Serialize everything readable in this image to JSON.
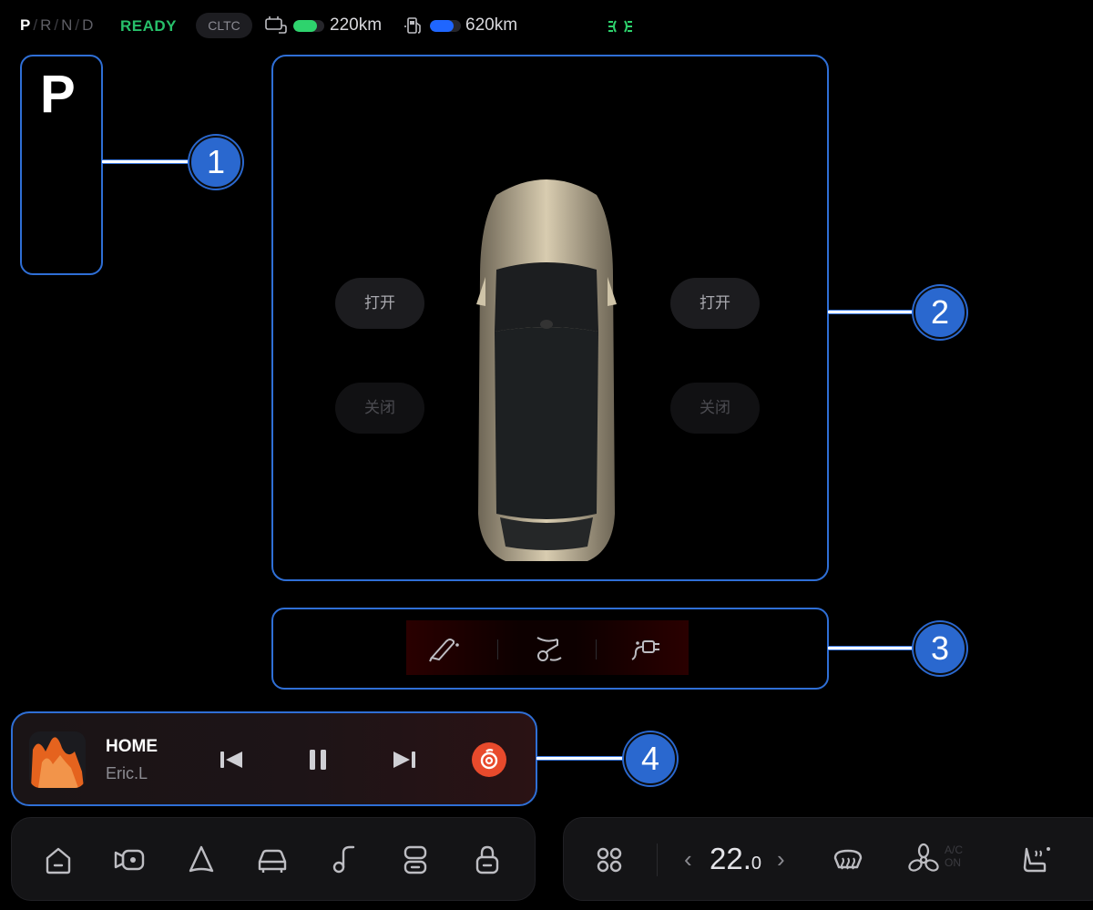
{
  "status": {
    "gears": [
      "P",
      "R",
      "N",
      "D"
    ],
    "active_gear": "P",
    "ready": "READY",
    "cltc": "CLTC",
    "battery_range": "220km",
    "battery_level": 0.75,
    "fuel_range": "620km",
    "fuel_level": 0.75,
    "colors": {
      "ready": "#27c06a",
      "battery": "#2ed36d",
      "fuel": "#1f66ff",
      "lamp": "#2ed36d"
    },
    "icons": [
      "battery-icon",
      "fuel-pump-icon",
      "position-lamp-icon"
    ]
  },
  "gear_panel": {
    "current": "P"
  },
  "callouts": [
    "1",
    "2",
    "3",
    "4"
  ],
  "car_panel": {
    "left_open": "打开",
    "left_close": "关闭",
    "right_open": "打开",
    "right_close": "关闭"
  },
  "charge_panel": {
    "icons": [
      "charge-port-open-icon",
      "charge-cable-icon",
      "charge-plug-icon"
    ]
  },
  "media": {
    "title": "HOME",
    "artist": "Eric.L",
    "controls": [
      "previous-icon",
      "pause-icon",
      "next-icon",
      "netease-music-icon"
    ]
  },
  "dock": {
    "icons": [
      "home-icon",
      "camera-icon",
      "navigation-icon",
      "car-icon",
      "music-icon",
      "apps-toggle-icon",
      "lock-icon"
    ]
  },
  "climate": {
    "temperature": "22.",
    "temperature_decimal": "0",
    "ac_label_top": "A/C",
    "ac_label_bottom": "ON",
    "icons": [
      "apps-grid-icon",
      "rear-defrost-icon",
      "fan-icon",
      "seat-heat-icon"
    ]
  }
}
